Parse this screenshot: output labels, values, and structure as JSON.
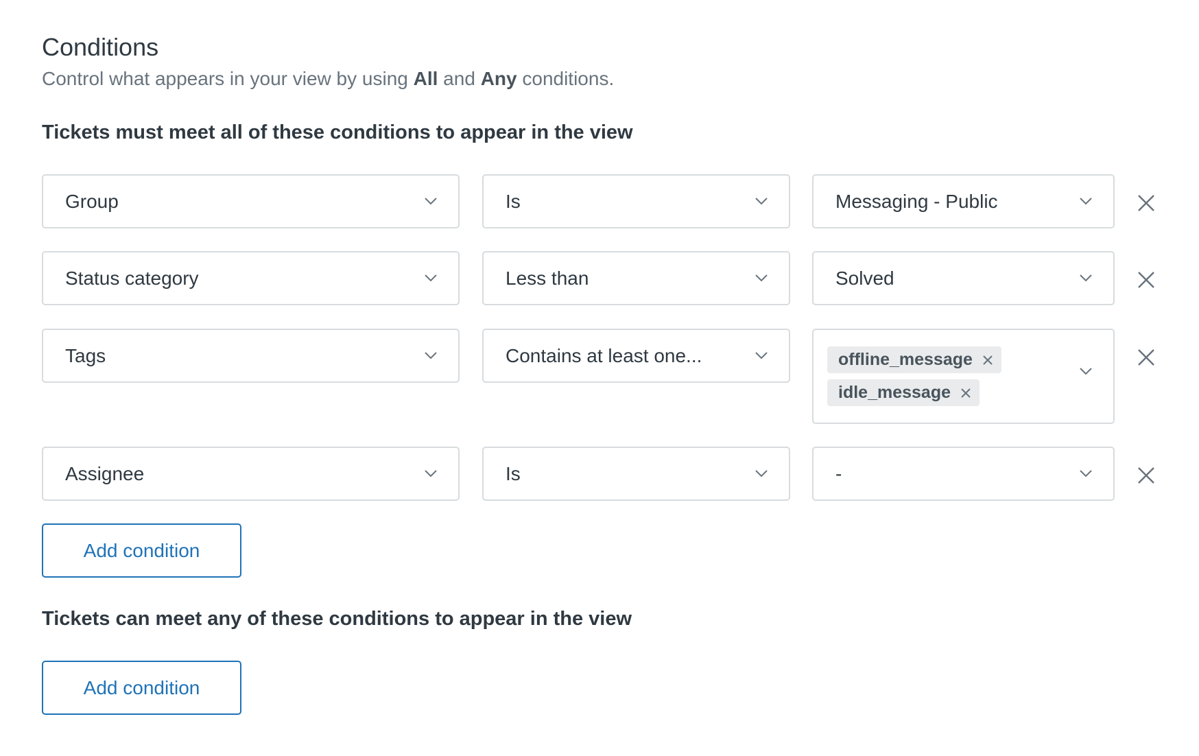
{
  "header": {
    "title": "Conditions",
    "subtitle_pre": "Control what appears in your view by using ",
    "subtitle_all": "All",
    "subtitle_and": " and ",
    "subtitle_any": "Any",
    "subtitle_post": " conditions."
  },
  "all_section": {
    "heading": "Tickets must meet all of these conditions to appear in the view",
    "rows": [
      {
        "field": "Group",
        "operator": "Is",
        "value": "Messaging - Public"
      },
      {
        "field": "Status category",
        "operator": "Less than",
        "value": "Solved"
      },
      {
        "field": "Tags",
        "operator": "Contains at least one...",
        "tags": [
          "offline_message",
          "idle_message"
        ]
      },
      {
        "field": "Assignee",
        "operator": "Is",
        "value": "-"
      }
    ],
    "add_label": "Add condition"
  },
  "any_section": {
    "heading": "Tickets can meet any of these conditions to appear in the view",
    "add_label": "Add condition"
  },
  "icons": {
    "dropdown": "chevron-down-icon",
    "remove": "close-icon",
    "tag_remove": "close-small-icon"
  },
  "colors": {
    "accent": "#1f73b7",
    "border": "#d8dcde",
    "text": "#2f3941",
    "muted": "#68737d",
    "tag_bg": "#e9ebed"
  }
}
